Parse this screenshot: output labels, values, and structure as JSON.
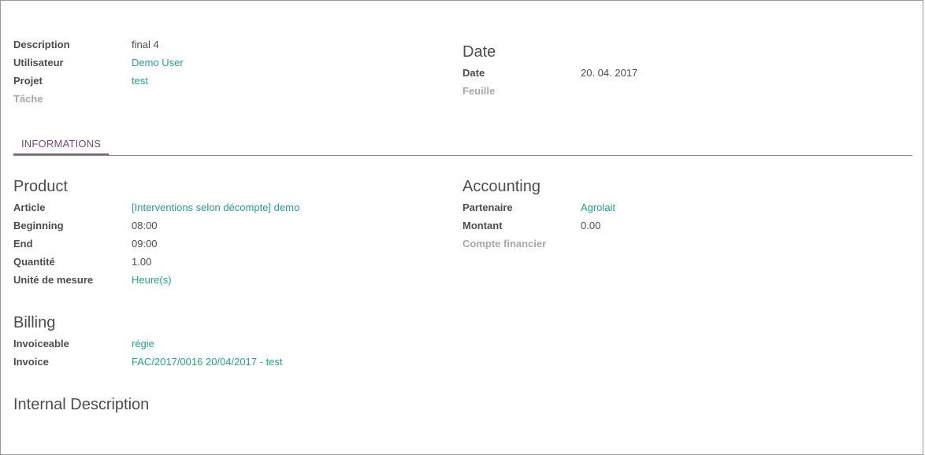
{
  "header_left": [
    {
      "label": "Description",
      "value": "final 4",
      "link": false,
      "muted": false
    },
    {
      "label": "Utilisateur",
      "value": "Demo User",
      "link": true,
      "muted": false
    },
    {
      "label": "Projet",
      "value": "test",
      "link": true,
      "muted": false
    },
    {
      "label": "Tâche",
      "value": "",
      "link": false,
      "muted": true
    }
  ],
  "date_group": {
    "title": "Date",
    "fields": [
      {
        "label": "Date",
        "value": "20. 04. 2017",
        "link": false,
        "muted": false
      },
      {
        "label": "Feuille",
        "value": "",
        "link": false,
        "muted": true
      }
    ]
  },
  "tabs": [
    {
      "label": "INFORMATIONS",
      "active": true
    }
  ],
  "product_group": {
    "title": "Product",
    "fields": [
      {
        "label": "Article",
        "value": "[Interventions selon décompte] demo",
        "link": true,
        "muted": false
      },
      {
        "label": "Beginning",
        "value": "08:00",
        "link": false,
        "muted": false
      },
      {
        "label": "End",
        "value": "09:00",
        "link": false,
        "muted": false
      },
      {
        "label": "Quantité",
        "value": "1.00",
        "link": false,
        "muted": false
      },
      {
        "label": "Unité de mesure",
        "value": "Heure(s)",
        "link": true,
        "muted": false
      }
    ]
  },
  "accounting_group": {
    "title": "Accounting",
    "fields": [
      {
        "label": "Partenaire",
        "value": "Agrolait",
        "link": true,
        "muted": false
      },
      {
        "label": "Montant",
        "value": "0.00",
        "link": false,
        "muted": false
      },
      {
        "label": "Compte financier",
        "value": "",
        "link": false,
        "muted": true
      }
    ]
  },
  "billing_group": {
    "title": "Billing",
    "fields": [
      {
        "label": "Invoiceable",
        "value": "régie",
        "link": true,
        "muted": false
      },
      {
        "label": "Invoice",
        "value": "FAC/2017/0016 20/04/2017 - test",
        "link": true,
        "muted": false
      }
    ]
  },
  "internal_description": {
    "title": "Internal Description"
  },
  "colors": {
    "link": "#21a28d",
    "label": "#4c4c4c",
    "muted": "#a8a8a8",
    "tab": "#875a7b"
  }
}
